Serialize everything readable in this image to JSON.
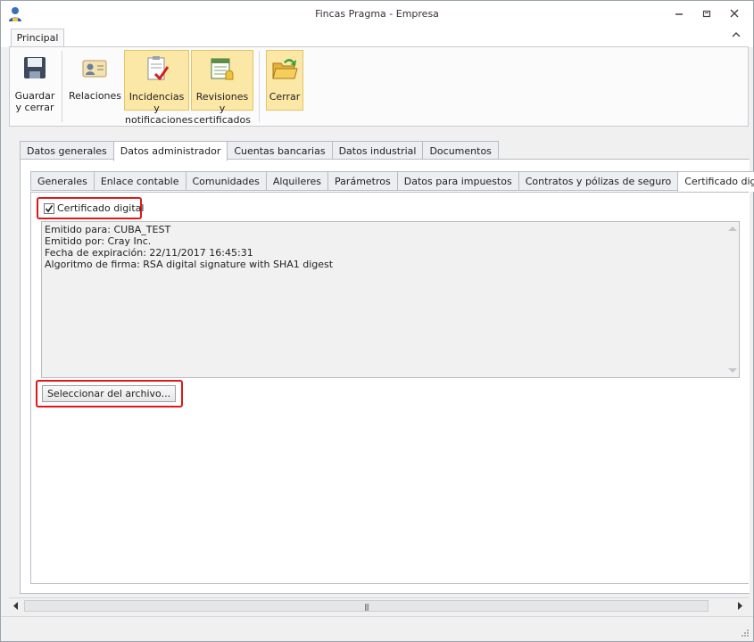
{
  "window": {
    "title": "Fincas Pragma - Empresa"
  },
  "ribbon": {
    "tab": "Principal",
    "buttons": {
      "save": "Guardar\ny cerrar",
      "relations": "Relaciones",
      "incidents": "Incidencias y\nnotificaciones",
      "reviews": "Revisiones y\ncertificados",
      "close": "Cerrar"
    }
  },
  "main_tabs": [
    "Datos generales",
    "Datos administrador",
    "Cuentas bancarias",
    "Datos industrial",
    "Documentos"
  ],
  "sub_tabs": [
    "Generales",
    "Enlace contable",
    "Comunidades",
    "Alquileres",
    "Parámetros",
    "Datos para impuestos",
    "Contratos y pólizas de seguro",
    "Certificado digital"
  ],
  "certificate": {
    "checkbox_label": "Certificado digital",
    "checked": true,
    "lines": [
      "Emitido para: CUBA_TEST",
      "Emitido por: Cray Inc.",
      "Fecha de expiración: 22/11/2017 16:45:31",
      "Algoritmo de firma: RSA digital signature with SHA1 digest"
    ],
    "select_file_button": "Seleccionar del archivo..."
  },
  "colors": {
    "highlight_box": "#e01818",
    "ribbon_selected": "#fbe7a6"
  }
}
